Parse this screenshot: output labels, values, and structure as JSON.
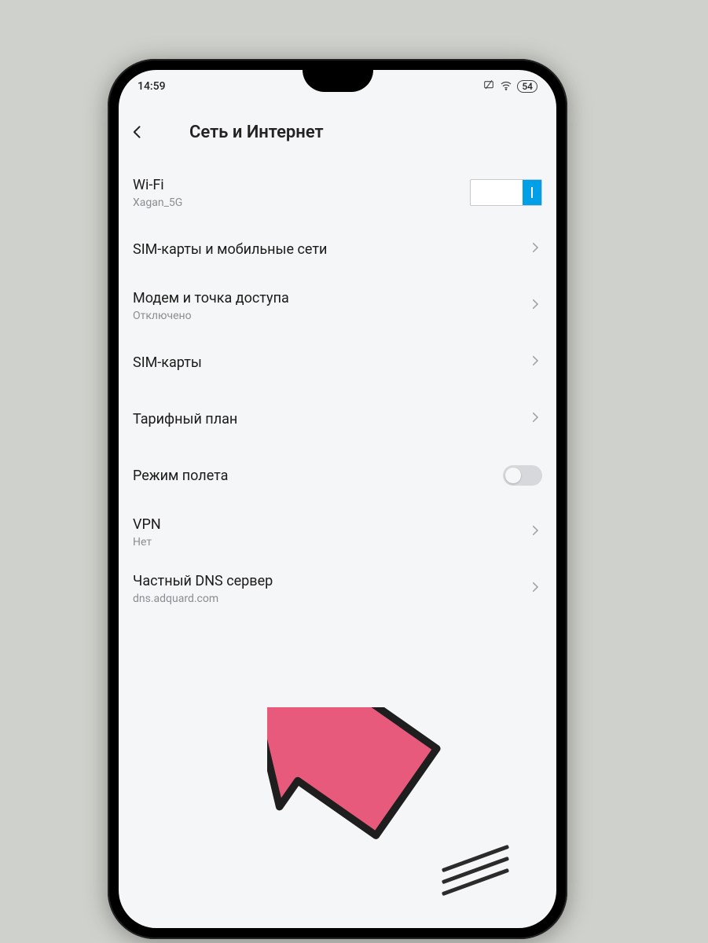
{
  "status": {
    "time": "14:59",
    "battery": "54"
  },
  "header": {
    "title": "Сеть и Интернет"
  },
  "rows": {
    "wifi": {
      "title": "Wi-Fi",
      "sub": "Xagan_5G",
      "toggle_on": true
    },
    "sim_net": {
      "title": "SIM-карты и мобильные сети"
    },
    "tether": {
      "title": "Модем и точка доступа",
      "sub": "Отключено"
    },
    "sim": {
      "title": "SIM-карты"
    },
    "tariff": {
      "title": "Тарифный план"
    },
    "airplane": {
      "title": "Режим полета",
      "toggle_on": false
    },
    "vpn": {
      "title": "VPN",
      "sub": "Нет"
    },
    "dns": {
      "title": "Частный DNS сервер",
      "sub": "dns.adquard.com"
    }
  }
}
